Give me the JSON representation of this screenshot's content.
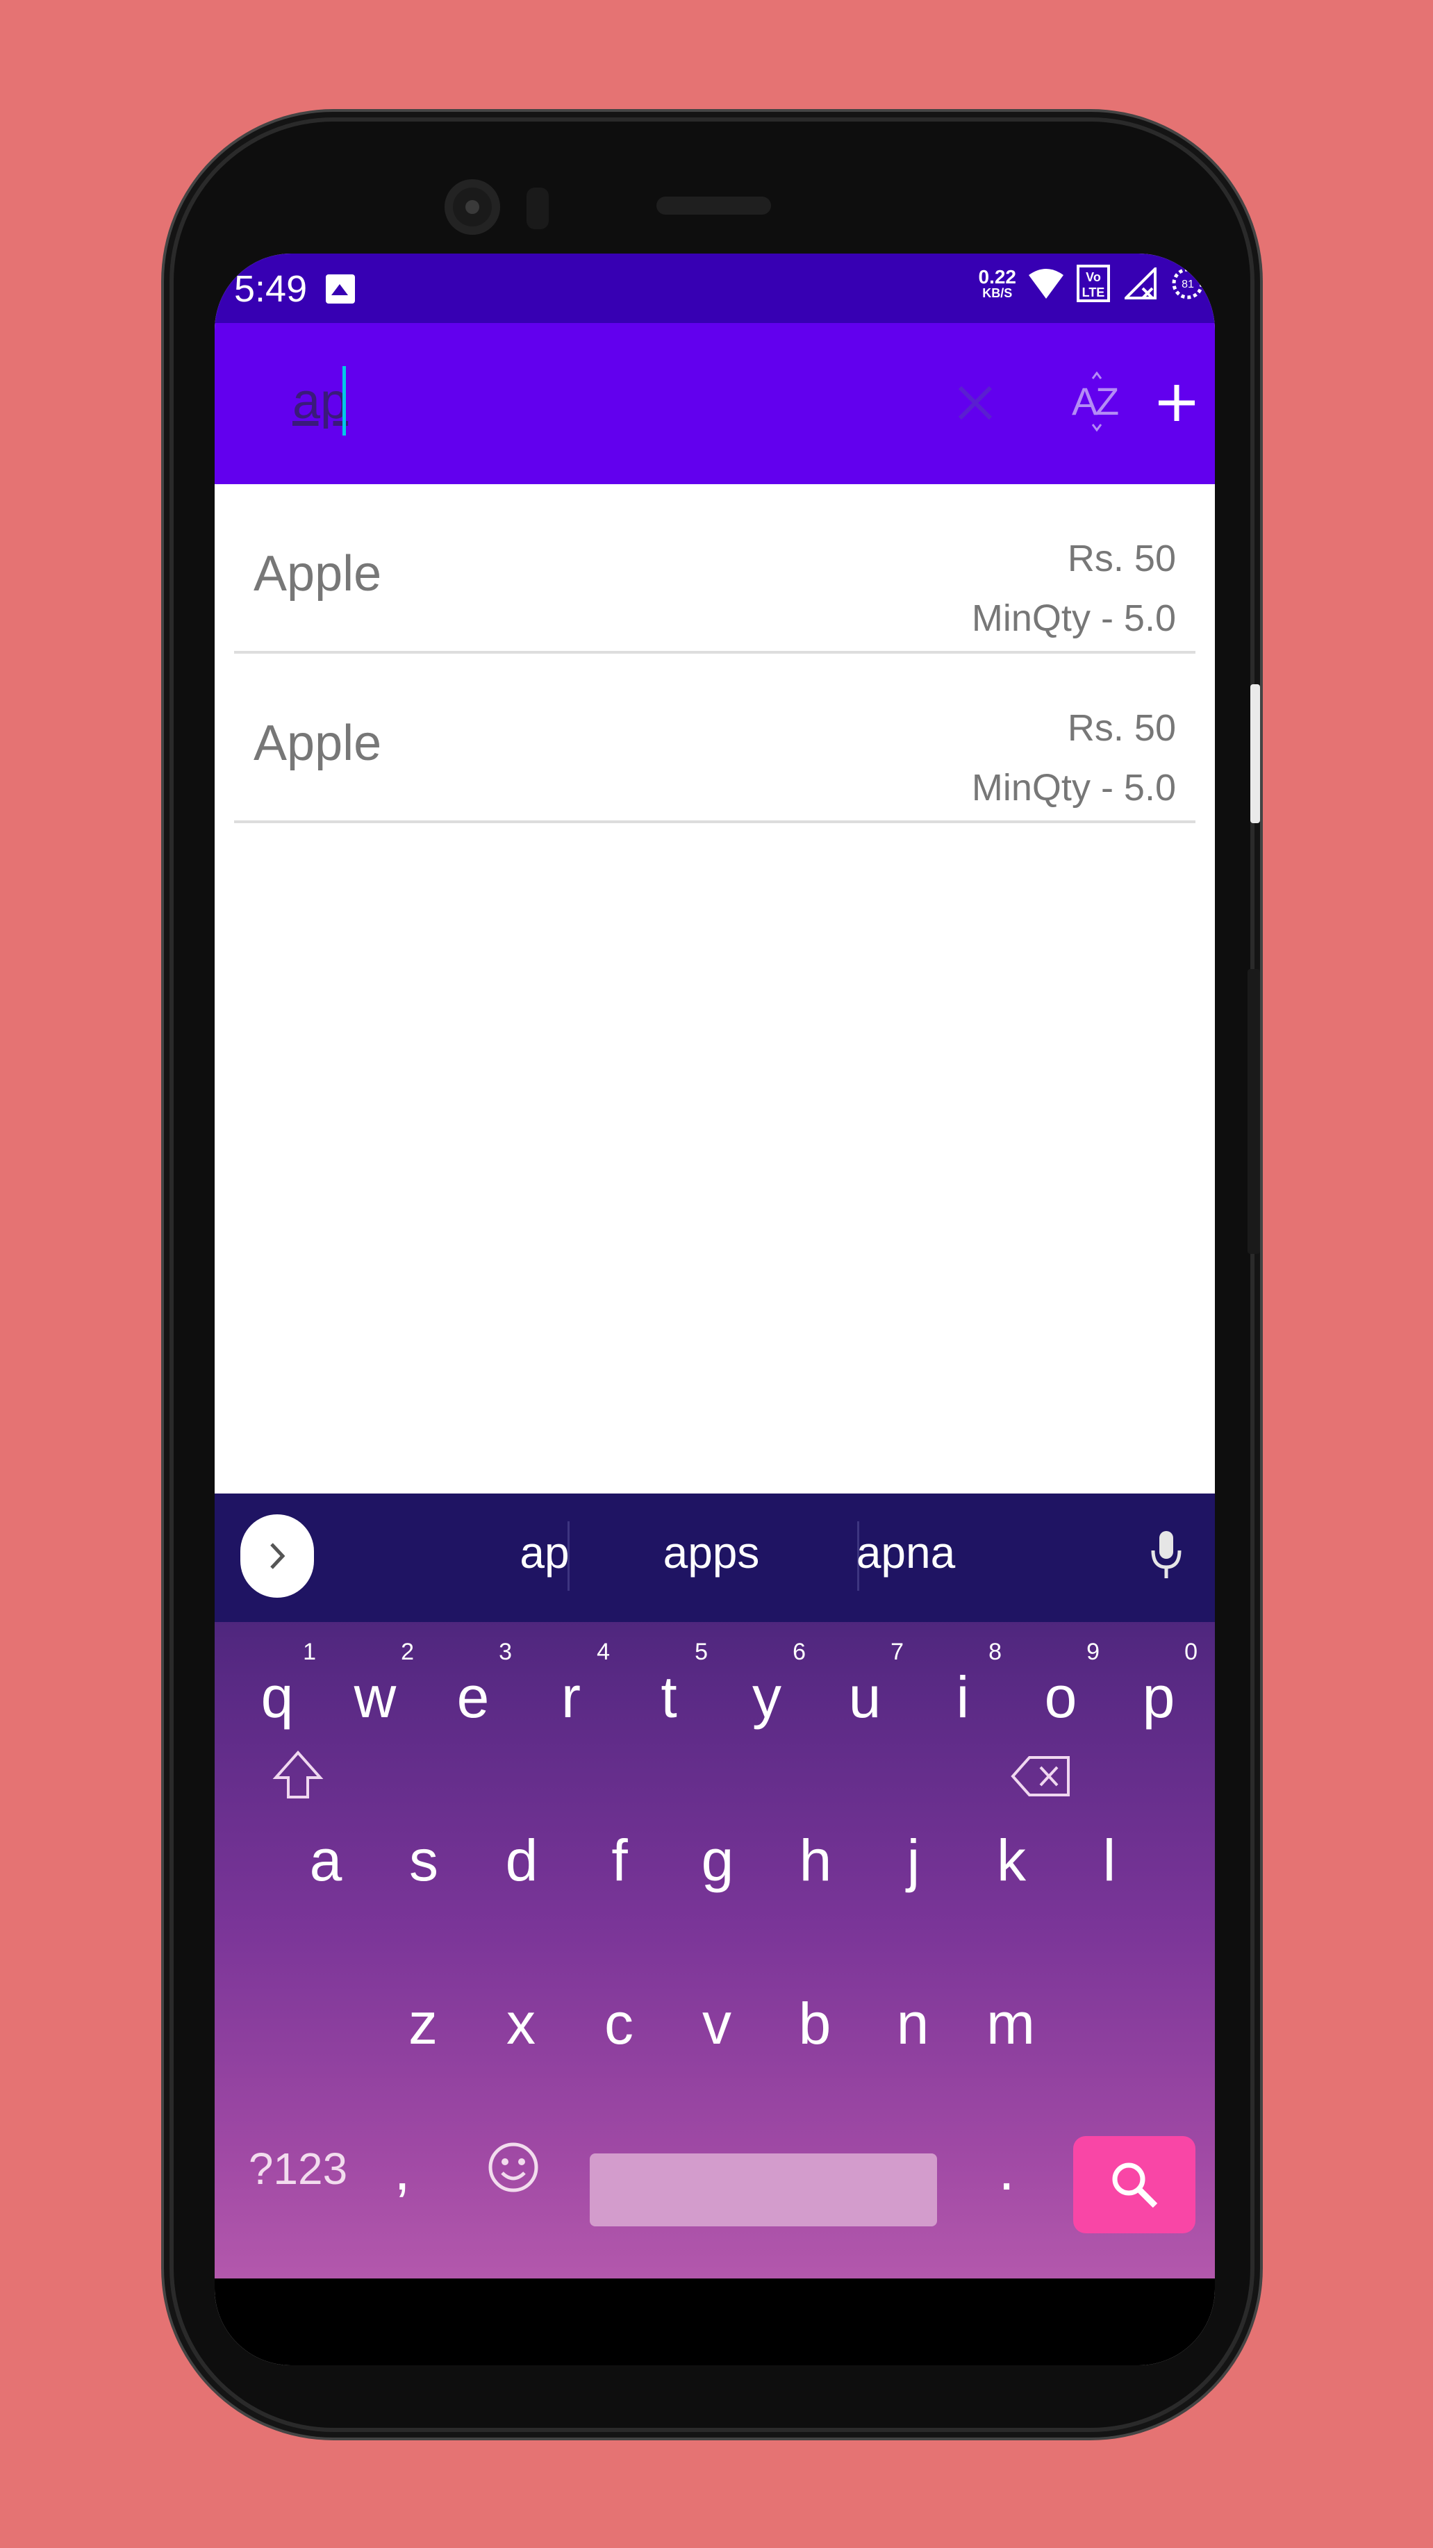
{
  "status_bar": {
    "time": "5:49",
    "net_speed_value": "0.22",
    "net_speed_unit": "KB/S",
    "lte_label": "Vo LTE",
    "battery": "81"
  },
  "app_bar": {
    "search_text": "ap",
    "clear_icon": "close-icon",
    "sort_icon": "sort-az-icon",
    "add_icon": "plus-icon"
  },
  "items": [
    {
      "name": "Apple",
      "price": "Rs. 50",
      "min_qty": "MinQty - 5.0"
    },
    {
      "name": "Apple",
      "price": "Rs. 50",
      "min_qty": "MinQty - 5.0"
    }
  ],
  "keyboard": {
    "suggestions": [
      "ap",
      "apps",
      "apna"
    ],
    "row1": [
      {
        "k": "q",
        "n": "1"
      },
      {
        "k": "w",
        "n": "2"
      },
      {
        "k": "e",
        "n": "3"
      },
      {
        "k": "r",
        "n": "4"
      },
      {
        "k": "t",
        "n": "5"
      },
      {
        "k": "y",
        "n": "6"
      },
      {
        "k": "u",
        "n": "7"
      },
      {
        "k": "i",
        "n": "8"
      },
      {
        "k": "o",
        "n": "9"
      },
      {
        "k": "p",
        "n": "0"
      }
    ],
    "row2": [
      "a",
      "s",
      "d",
      "f",
      "g",
      "h",
      "j",
      "k",
      "l"
    ],
    "row3": [
      "z",
      "x",
      "c",
      "v",
      "b",
      "n",
      "m"
    ],
    "symbols_label": "?123",
    "comma": ",",
    "period": "."
  },
  "colors": {
    "status_bar": "#3700b3",
    "app_bar": "#6200ee",
    "background": "#e57373",
    "enter_key": "#f946a6"
  }
}
